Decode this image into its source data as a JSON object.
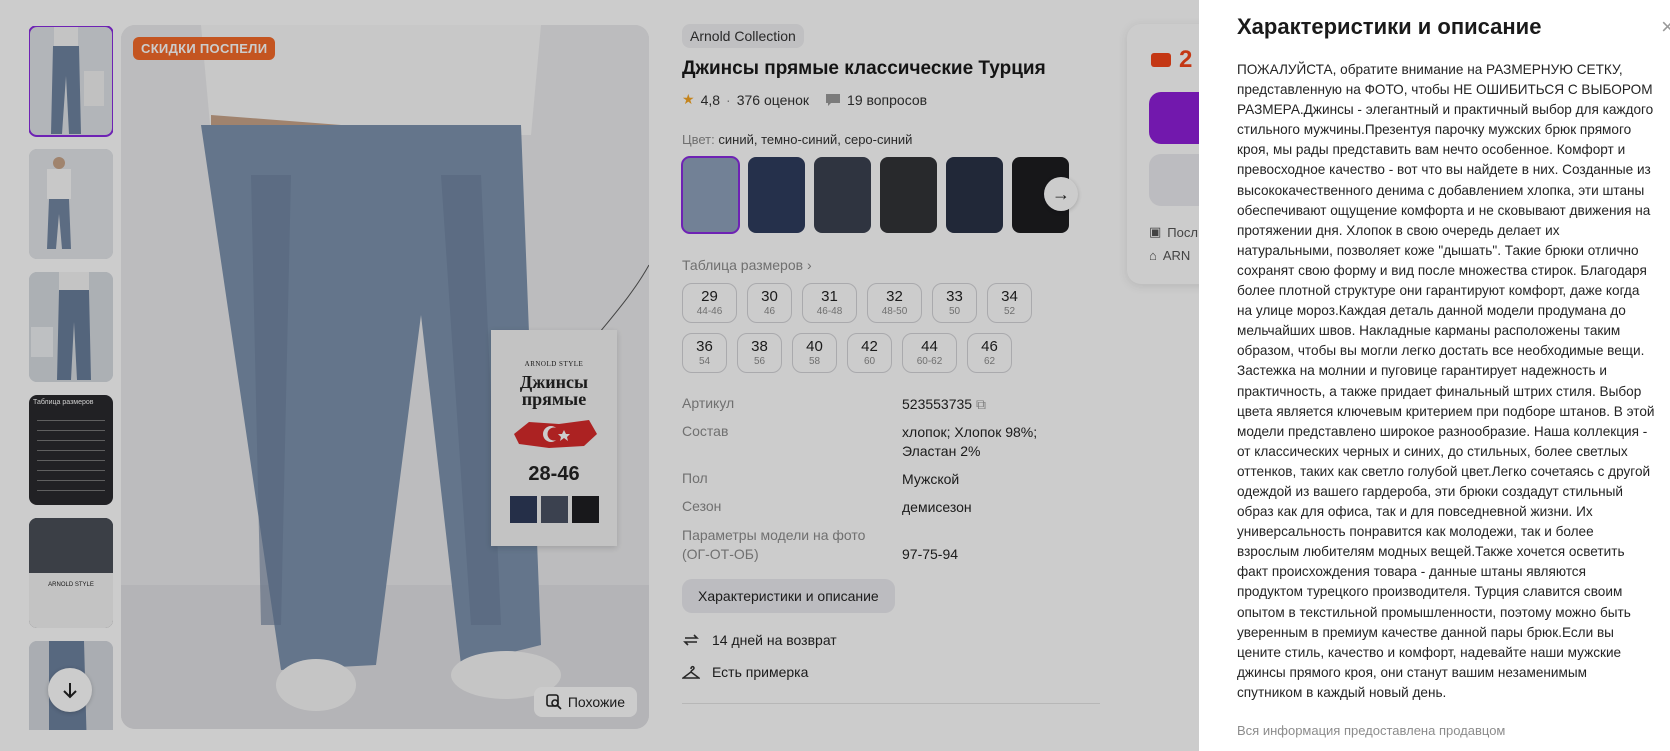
{
  "gallery": {
    "sale_badge": "СКИДКИ ПОСПЕЛИ",
    "similar_label": "Похожие",
    "tag_brand": "ARNOLD STYLE",
    "tag_name": "Джинсы прямые",
    "tag_range": "28-46",
    "thumb_size_table": "Таблица размеров",
    "thumb_brand": "ARNOLD STYLE"
  },
  "product": {
    "brand": "Arnold Collection",
    "title": "Джинсы прямые классические Турция",
    "rating": "4,8",
    "reviews": "376 оценок",
    "questions": "19 вопросов",
    "color_label": "Цвет:",
    "color_value": "синий, темно-синий, серо-синий",
    "size_table_link": "Таблица размеров",
    "sizes": [
      {
        "n": "29",
        "r": "44-46"
      },
      {
        "n": "30",
        "r": "46"
      },
      {
        "n": "31",
        "r": "46-48"
      },
      {
        "n": "32",
        "r": "48-50"
      },
      {
        "n": "33",
        "r": "50"
      },
      {
        "n": "34",
        "r": "52"
      },
      {
        "n": "36",
        "r": "54"
      },
      {
        "n": "38",
        "r": "56"
      },
      {
        "n": "40",
        "r": "58"
      },
      {
        "n": "42",
        "r": "60"
      },
      {
        "n": "44",
        "r": "60-62"
      },
      {
        "n": "46",
        "r": "62"
      }
    ],
    "params": [
      {
        "k": "Артикул",
        "v": "523553735"
      },
      {
        "k": "Состав",
        "v": "хлопок; Хлопок 98%; Эластан 2%"
      },
      {
        "k": "Пол",
        "v": "Мужской"
      },
      {
        "k": "Сезон",
        "v": "демисезон"
      },
      {
        "k": "Параметры модели на фото (ОГ-ОТ-ОБ)",
        "v": "97-75-94"
      }
    ],
    "char_button": "Характеристики и описание",
    "return_label": "14 дней на возврат",
    "fitting_label": "Есть примерка"
  },
  "buy_card": {
    "price_partial": "2",
    "line1": "Посл",
    "line2": "ARN"
  },
  "panel": {
    "title": "Характеристики и описание",
    "description": "ПОЖАЛУЙСТА, обратите внимание на РАЗМЕРНУЮ СЕТКУ, представленную на ФОТО, чтобы НЕ ОШИБИТЬСЯ С ВЫБОРОМ РАЗМЕРА.Джинсы - элегантный и практичный выбор для каждого стильного мужчины.Презентуя парочку мужских брюк прямого кроя, мы рады представить вам нечто особенное. Комфорт и превосходное качество - вот что вы найдете в них. Созданные из высококачественного денима с добавлением хлопка, эти штаны обеспечивают ощущение комфорта и не сковывают движения на протяжении дня. Хлопок в свою очередь делает их натуральными, позволяет коже \"дышать\". Такие брюки отлично сохранят свою форму и вид после множества стирок. Благодаря более плотной структуре они гарантируют комфорт, даже когда на улице мороз.Каждая деталь данной модели продумана до мельчайших швов. Накладные карманы расположены таким образом, чтобы вы могли легко достать все необходимые вещи. Застежка на молнии и пуговице гарантирует надежность и практичность, а также придает финальный штрих стиля. Выбор цвета является ключевым критерием при подборе штанов. В этой модели представлено широкое разнообразие. Наша коллекция - от классических черных и синих, до стильных, более светлых оттенков, таких как светло голубой цвет.Легко сочетаясь с другой одеждой из вашего гардероба, эти брюки создадут стильный образ как для офиса, так и для повседневной жизни. Их универсальность понравится как молодежи, так и более взрослым любителям модных вещей.Также хочется осветить факт происхождения товара - данные штаны являются продуктом турецкого производителя. Турция славится своим опытом в текстильной промышленности, поэтому можно быть уверенным в премиум качестве данной пары брюк.Если вы цените стиль, качество и комфорт, надевайте наши мужские джинсы прямого кроя, они станут вашим незаменимым спутником в каждый новый день.",
    "footer": "Вся информация предоставлена продавцом"
  },
  "colors": {
    "accent": "#8a2be2",
    "sale": "#f56b2a",
    "price": "#f5451a"
  }
}
